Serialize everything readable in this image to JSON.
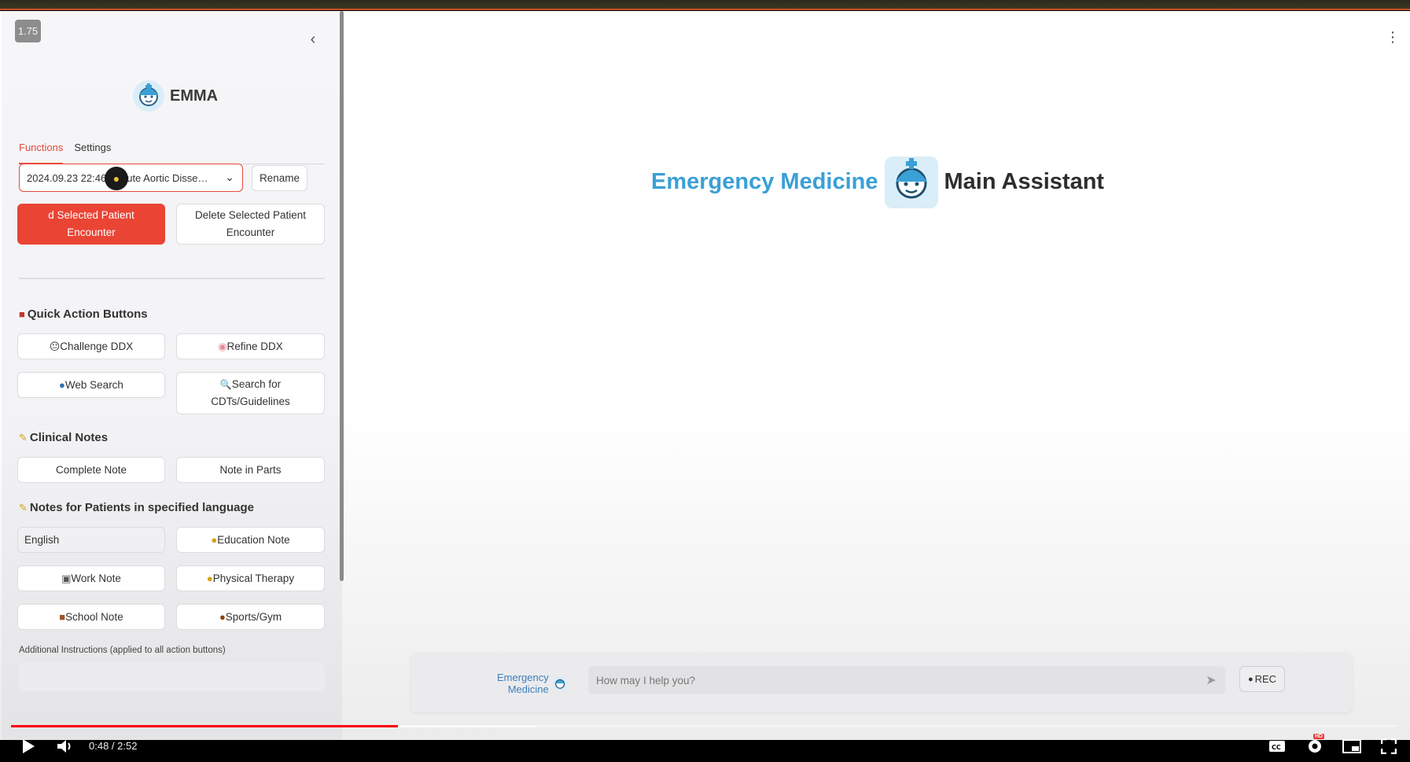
{
  "playback": {
    "speed": "1.75",
    "time": "0:48 / 2:52",
    "progress": 0.279,
    "buffered": 0.379
  },
  "sidebar": {
    "brand": "EMMA",
    "tabs": [
      {
        "label": "Functions"
      },
      {
        "label": "Settings"
      }
    ],
    "encounter_select": "2024.09.23 22:46 - Acute Aortic Disse…",
    "rename_label": "Rename",
    "load_label": "Load Selected Patient Encounter",
    "load_label_visible": "d Selected Patient Encounter",
    "delete_label": "Delete Selected Patient Encounter",
    "quick_actions": {
      "heading": "Quick Action Buttons",
      "challenge": "Challenge DDX",
      "refine": "Refine DDX",
      "web": "Web Search",
      "cdt": "Search for CDTs/Guidelines"
    },
    "clinical_notes": {
      "heading": "Clinical Notes",
      "complete": "Complete Note",
      "parts": "Note in Parts"
    },
    "patient_notes": {
      "heading": "Notes for Patients in specified language",
      "language": "English",
      "education": "Education Note",
      "work": "Work Note",
      "physical": "Physical Therapy",
      "school": "School Note",
      "sports": "Sports/Gym"
    },
    "additional_label": "Additional Instructions (applied to all action buttons)",
    "additional_value": ""
  },
  "main": {
    "hero_left": "Emergency Medicine",
    "hero_right": "Main Assistant",
    "chat_brand_line1": "Emergency",
    "chat_brand_line2": "Medicine",
    "chat_placeholder": "How may I help you?",
    "rec_label": "REC"
  },
  "colors": {
    "accent": "#ea4435",
    "brand_blue": "#3aa0d6",
    "progress": "#ff0000"
  },
  "icons": [
    "chevron-left-icon",
    "kebab-menu-icon",
    "toolbox-icon",
    "pencil-icon",
    "send-icon",
    "mic-icon",
    "play-icon",
    "volume-icon",
    "captions-icon",
    "settings-icon",
    "miniplayer-icon",
    "fullscreen-icon"
  ]
}
